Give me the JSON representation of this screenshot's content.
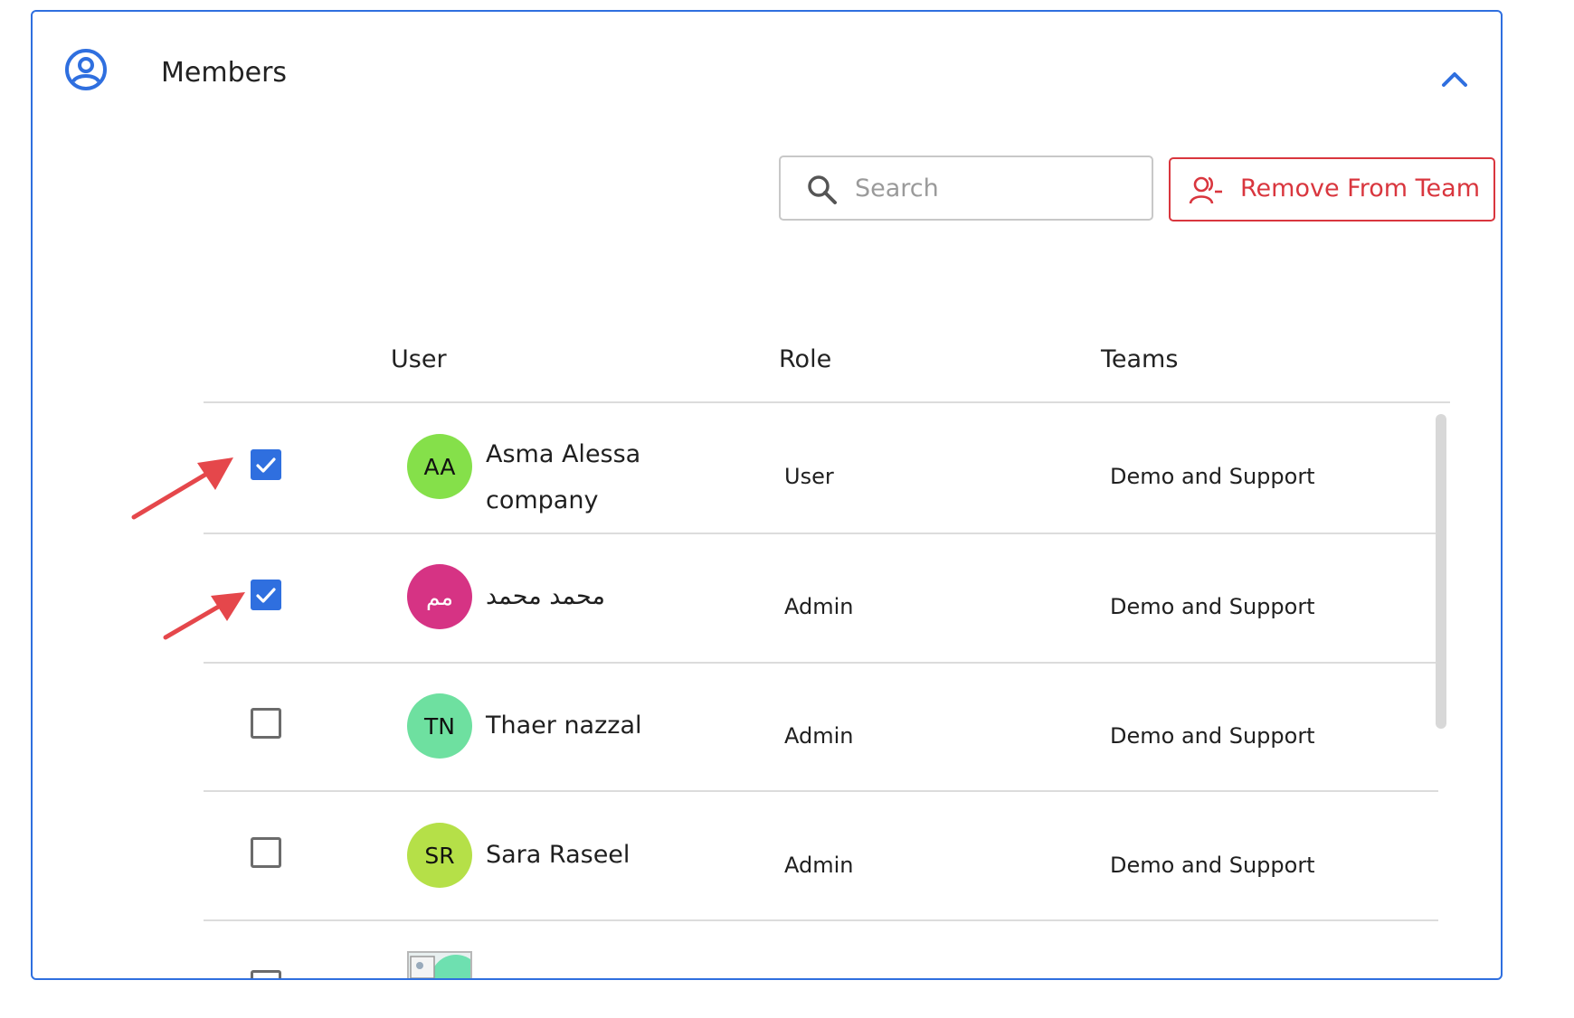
{
  "panel": {
    "title": "Members"
  },
  "search": {
    "placeholder": "Search",
    "value": ""
  },
  "actions": {
    "remove_label": "Remove From Team"
  },
  "table": {
    "columns": [
      "User",
      "Role",
      "Teams"
    ],
    "rows": [
      {
        "initials": "AA",
        "avatar_color": "#85e04a",
        "name": "Asma Alessa company",
        "role": "User",
        "teams": "Demo and Support",
        "checked": true
      },
      {
        "initials": "مم",
        "avatar_color": "#d63384",
        "name": "محمد محمد",
        "role": "Admin",
        "teams": "Demo and Support",
        "checked": true
      },
      {
        "initials": "TN",
        "avatar_color": "#6ee0a0",
        "name": "Thaer nazzal",
        "role": "Admin",
        "teams": "Demo and Support",
        "checked": false
      },
      {
        "initials": "SR",
        "avatar_color": "#b5e048",
        "name": "Sara Raseel",
        "role": "Admin",
        "teams": "Demo and Support",
        "checked": false
      }
    ]
  },
  "colors": {
    "accent": "#2f6fdf",
    "danger": "#d9363e",
    "annotation_arrow": "#e5474b"
  },
  "icons": {
    "header": "user-circle-icon",
    "collapse": "chevron-up-icon",
    "search": "search-icon",
    "remove": "user-minus-icon"
  }
}
